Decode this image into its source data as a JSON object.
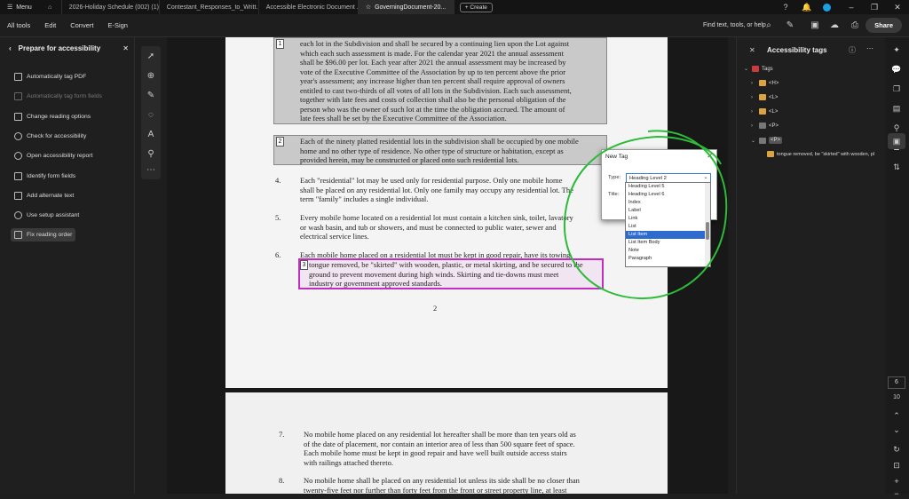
{
  "titlebar": {
    "menu_label": "Menu",
    "tabs": [
      "2026-Holiday Schedule (002) (1)...",
      "Contestant_Responses_to_Writt...",
      "Accessible Electronic Document ...",
      "GoverningDocument-20..."
    ],
    "create_label": "Create"
  },
  "toolbar": {
    "links": [
      "All tools",
      "Edit",
      "Convert",
      "E-Sign"
    ],
    "search_label": "Find text, tools, or help",
    "share_label": "Share"
  },
  "left_panel": {
    "title": "Prepare for accessibility",
    "items": [
      {
        "label": "Automatically tag PDF",
        "disabled": false
      },
      {
        "label": "Automatically tag form fields",
        "disabled": true
      },
      {
        "label": "Change reading options",
        "disabled": false
      },
      {
        "label": "Check for accessibility",
        "disabled": false
      },
      {
        "label": "Open accessibility report",
        "disabled": false
      },
      {
        "label": "Identify form fields",
        "disabled": false
      },
      {
        "label": "Add alternate text",
        "disabled": false
      },
      {
        "label": "Use setup assistant",
        "disabled": false
      },
      {
        "label": "Fix reading order",
        "disabled": false
      }
    ]
  },
  "document": {
    "block1_lines": [
      "each lot in the Subdivision and shall be secured by a continuing lien upon the Lot against",
      "which each such assessment is made.  For the calendar year 2021 the annual assessment",
      "shall be $96.00 per lot.  Each year after 2021 the annual assessment may be increased by",
      "vote of the Executive Committee of the Association by up to ten percent above the prior",
      "year's assessment; any increase higher than ten percent shall require approval of owners",
      "entitled to cast two-thirds of all votes of all lots in the Subdivision.  Each such assessment,",
      "together with late fees and costs of collection shall also be the personal obligation of the",
      "person who was the owner of such lot at the time the obligation accrued.  The amount of",
      "late fees shall be set by the Executive Committee of the Association."
    ],
    "block2_lines": [
      "Each of the ninety platted residential lots in the subdivision shall be occupied by one mobile",
      "home and no other type of residence. No other type of structure or habitation, except as",
      "provided herein, may be constructed or placed onto such residential lots."
    ],
    "item4_num": "4.",
    "item4_lines": [
      "Each \"residential\" lot may be used only for residential purpose. Only one mobile home",
      "shall be placed on any residential lot. Only one family may occupy any residential lot. The",
      "term \"family\" includes a single individual."
    ],
    "item5_num": "5.",
    "item5_lines": [
      "Every mobile home located on a residential lot must contain a kitchen sink, toilet, lavatory",
      "or wash basin, and tub or showers, and must be connected to public water, sewer and",
      "electrical service lines."
    ],
    "item6_num": "6.",
    "item6_line": "Each mobile home placed on a residential lot must be kept in good repair, have its towing",
    "item6_tag_lines": [
      "tongue removed, be \"skirted\" with wooden, plastic, or metal skirting, and be secured to the",
      "ground to prevent movement during high winds.  Skirting and tie-downs must meet",
      "industry or government approved standards."
    ],
    "page_number": "2",
    "tag1": "1",
    "tag2": "2",
    "tag3": "3",
    "item7_num": "7.",
    "item7_lines": [
      "No mobile home placed on any residential lot hereafter shall be more than ten years old as",
      "of the date of placement, nor contain an interior area of less than 500 square feet of space.",
      "Each mobile home must be kept in good repair and have well built outside access stairs",
      "with railings attached thereto."
    ],
    "item8_num": "8.",
    "item8_lines": [
      "No mobile home shall be placed on any residential lot unless its side shall be no closer than",
      "twenty-five feet nor further than forty feet from the front or street property line, at least"
    ]
  },
  "new_tag_dialog": {
    "title": "New Tag",
    "type_label": "Type:",
    "type_value": "Heading Level 2",
    "title_label": "Title:",
    "options": [
      "Heading Level 5",
      "Heading Level 6",
      "Index",
      "Label",
      "Link",
      "List",
      "List Item",
      "List Item Body",
      "Note",
      "Paragraph"
    ],
    "selected_option": "List Item"
  },
  "right_panel": {
    "title": "Accessibility tags",
    "tree": {
      "root": "Tags",
      "children": [
        "<H>",
        "<L>",
        "<L>",
        "<P>",
        "<P>"
      ],
      "leaf": "tongue removed, be \"skirted\" with wooden, pl"
    }
  },
  "rail": {
    "page_current": "6",
    "page_total": "10"
  },
  "colors": {
    "magenta": "#c02ec0",
    "annotation_green": "#2dbb3a",
    "selected_blue": "#2d6bcf"
  }
}
